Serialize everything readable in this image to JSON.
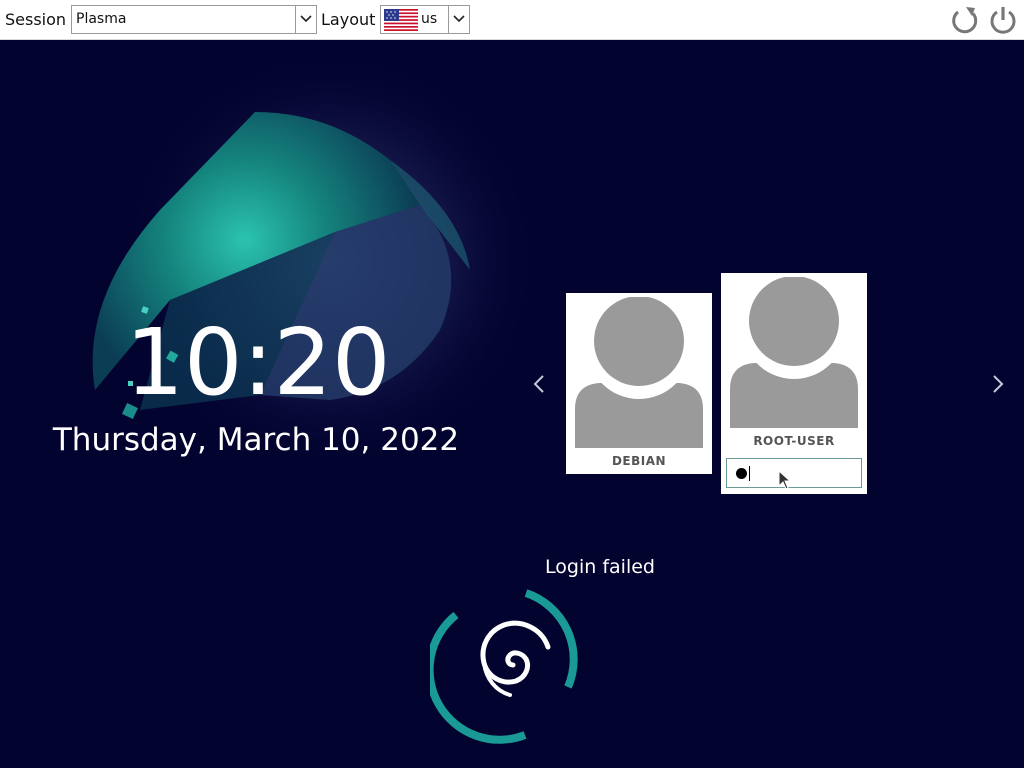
{
  "topbar": {
    "session_label": "Session",
    "session_value": "Plasma",
    "layout_label": "Layout",
    "layout_value": "us",
    "layout_flag": "us-flag-icon",
    "reboot_icon": "reboot-icon",
    "power_icon": "power-icon"
  },
  "clock": {
    "time": "10:20",
    "date": "Thursday, March 10, 2022"
  },
  "users": [
    {
      "name": "DEBIAN",
      "avatar": "user-avatar-icon"
    },
    {
      "name": "ROOT-USER",
      "avatar": "user-avatar-icon",
      "selected": true,
      "password_length": 1
    }
  ],
  "status_message": "Login failed",
  "colors": {
    "background": "#030330",
    "accent": "#1a9a96",
    "avatar_gray": "#9a9a9a",
    "text": "#ffffff"
  }
}
